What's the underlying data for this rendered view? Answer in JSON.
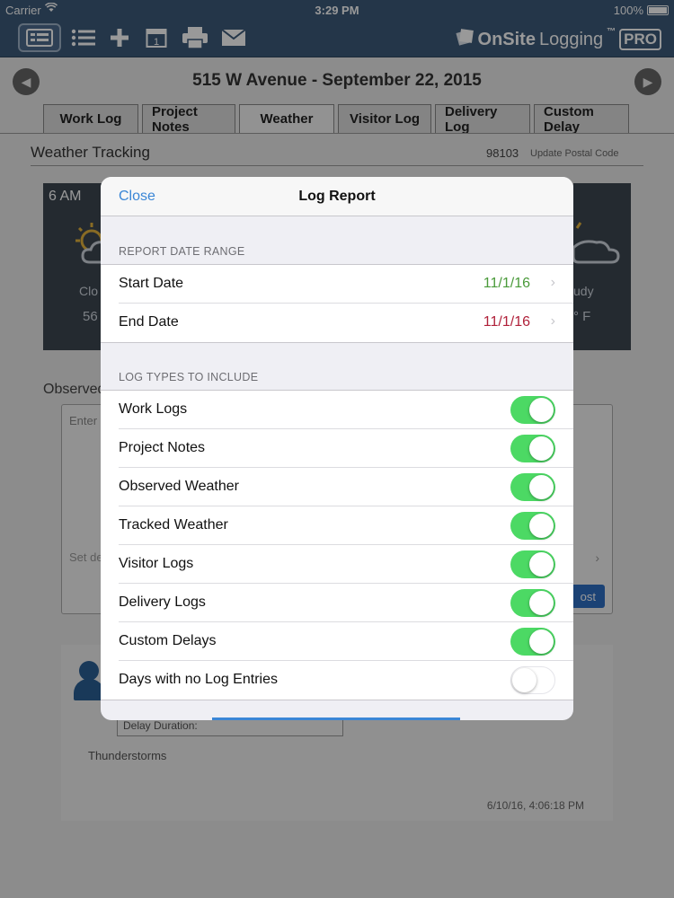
{
  "status_bar": {
    "carrier": "Carrier",
    "time": "3:29 PM",
    "battery": "100%"
  },
  "toolbar": {
    "brand_main": "OnSite",
    "brand_light": "Logging",
    "brand_tm": "™",
    "brand_badge": "PRO",
    "icons": [
      "dashboard-icon",
      "list-icon",
      "plus-icon",
      "calendar-icon",
      "print-icon",
      "mail-icon"
    ],
    "calendar_day": "1"
  },
  "header": {
    "title": "515 W Avenue - September 22, 2015"
  },
  "tabs": [
    "Work Log",
    "Project Notes",
    "Weather",
    "Visitor Log",
    "Delivery Log",
    "Custom Delay"
  ],
  "weather": {
    "section_title": "Weather Tracking",
    "postal_code": "98103",
    "update_link": "Update Postal Code",
    "cards": [
      {
        "hour": "6 AM",
        "condition": "Clo",
        "temp": "56"
      },
      {
        "hour": "",
        "condition": "udy",
        "temp": "° F"
      }
    ],
    "observed_label": "Observed",
    "enter_placeholder": "Enter",
    "set_placeholder": "Set de",
    "post_label": "ost"
  },
  "entry": {
    "delay_label": "Delay Duration:",
    "text": "Thunderstorms",
    "timestamp": "6/10/16, 4:06:18 PM"
  },
  "modal": {
    "close_label": "Close",
    "title": "Log Report",
    "date_range_header": "REPORT DATE RANGE",
    "start_label": "Start Date",
    "start_value": "11/1/16",
    "end_label": "End Date",
    "end_value": "11/1/16",
    "log_types_header": "LOG TYPES TO INCLUDE",
    "log_types": [
      {
        "label": "Work Logs",
        "on": true
      },
      {
        "label": "Project Notes",
        "on": true
      },
      {
        "label": "Observed Weather",
        "on": true
      },
      {
        "label": "Tracked Weather",
        "on": true
      },
      {
        "label": "Visitor Logs",
        "on": true
      },
      {
        "label": "Delivery Logs",
        "on": true
      },
      {
        "label": "Custom Delays",
        "on": true
      },
      {
        "label": "Days with no Log Entries",
        "on": false
      }
    ]
  },
  "colors": {
    "toolbar_bg": "#3c5a7a",
    "start_date": "#4a9a3a",
    "end_date": "#b0213a",
    "toggle_on": "#4cd964",
    "link_blue": "#3a86d6"
  }
}
